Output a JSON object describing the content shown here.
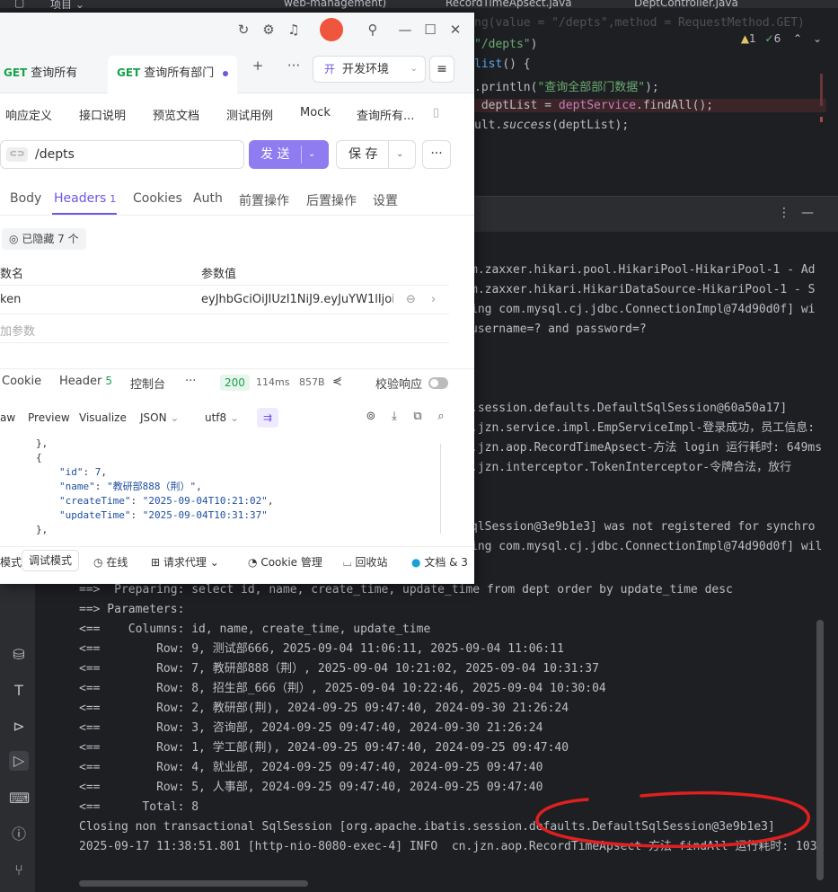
{
  "ide": {
    "titlebar": {
      "project_label": "项目",
      "project_chevron": "⌄",
      "module_tab": "web-management)",
      "tab_record": "RecordTimeApsect.java",
      "tab_dept": "DeptController.java"
    },
    "inspections": {
      "warnings": "1",
      "ok": "6"
    },
    "code_lines": [
      {
        "pre": "ng(value = \"/depts\",method = RequestMethod.GET)",
        "kind": "plain"
      },
      {
        "pre": "",
        "str": "\"/depts\"",
        "post": ")",
        "kind": "mapping"
      },
      {
        "pre": "",
        "fn": "list",
        "post": "() {",
        "kind": "method"
      },
      {
        "pre": ".println(",
        "str": "\"查询全部部门数据\"",
        "post": ");",
        "kind": "println"
      },
      {
        "pre": " deptList = ",
        "field": "deptService",
        "post2": ".findAll();",
        "kind": "assign"
      },
      {
        "pre": "ult.",
        "it": "success",
        "post": "(deptList);",
        "kind": "return"
      }
    ],
    "console_lines": [
      "m.zaxxer.hikari.pool.HikariPool-HikariPool-1 - Ad",
      "m.zaxxer.hikari.HikariDataSource-HikariPool-1 - S",
      "ing com.mysql.cj.jdbc.ConnectionImpl@74d90d0f] wi",
      "username=? and password=?",
      "",
      "",
      "",
      ".session.defaults.DefaultSqlSession@60a50a17]",
      ".jzn.service.impl.EmpServiceImpl-登录成功，员工信息:",
      ".jzn.aop.RecordTimeApsect-方法 login 运行耗时: 649ms",
      ".jzn.interceptor.TokenInterceptor-令牌合法，放行",
      "",
      "",
      "qlSession@3e9b1e3] was not registered for synchro",
      "ing com.mysql.cj.jdbc.ConnectionImpl@74d90d0f] wil"
    ],
    "sql_lines": [
      "==>  Preparing: select id, name, create_time, update_time from dept order by update_time desc",
      "==> Parameters: ",
      "<==    Columns: id, name, create_time, update_time",
      "<==        Row: 9, 测试部666, 2025-09-04 11:06:11, 2025-09-04 11:06:11",
      "<==        Row: 7, 教研部888（荆）, 2025-09-04 10:21:02, 2025-09-04 10:31:37",
      "<==        Row: 8, 招生部_666（荆）, 2025-09-04 10:22:46, 2025-09-04 10:30:04",
      "<==        Row: 2, 教研部(荆), 2024-09-25 09:47:40, 2024-09-30 21:26:24",
      "<==        Row: 3, 咨询部, 2024-09-25 09:47:40, 2024-09-30 21:26:24",
      "<==        Row: 1, 学工部(荆), 2024-09-25 09:47:40, 2024-09-25 09:47:40",
      "<==        Row: 4, 就业部, 2024-09-25 09:47:40, 2024-09-25 09:47:40",
      "<==        Row: 5, 人事部, 2024-09-25 09:47:40, 2024-09-25 09:47:40",
      "<==      Total: 8",
      "Closing non transactional SqlSession [org.apache.ibatis.session.defaults.DefaultSqlSession@3e9b1e3]",
      "2025-09-17 11:38:51.801 [http-nio-8080-exec-4] INFO  cn.jzn.aop.RecordTimeApsect-方法 findAll 运行耗时: 103"
    ],
    "colors": {
      "background": "#1e1f22",
      "annotation": "#e02020"
    }
  },
  "apifox": {
    "tabs": [
      {
        "method": "GET",
        "label": "查询所有"
      },
      {
        "method": "GET",
        "label": "查询所有部门"
      }
    ],
    "env": {
      "badge": "开",
      "label": "开发环境"
    },
    "doc_tabs": [
      "响应定义",
      "接口说明",
      "预览文档",
      "测试用例",
      "Mock",
      "查询所有..."
    ],
    "url": {
      "link_icon": "⊂⊃",
      "path": "/depts"
    },
    "send_label": "发 送",
    "save_label": "保 存",
    "param_tabs": [
      {
        "label": "Body"
      },
      {
        "label": "Headers",
        "count": "1"
      },
      {
        "label": "Cookies"
      },
      {
        "label": "Auth"
      },
      {
        "label": "前置操作"
      },
      {
        "label": "后置操作"
      },
      {
        "label": "设置"
      }
    ],
    "hidden_chip": "已隐藏 7 个",
    "headers_table": {
      "col_name": "数名",
      "col_value": "参数值",
      "rows": [
        {
          "name": "ken",
          "value": "eyJhbGciOiJIUzI1NiJ9.eyJuYW1lIjoi"
        }
      ],
      "add_placeholder": "加参数"
    },
    "response": {
      "tabs": [
        {
          "label": "Cookie"
        },
        {
          "label": "Header",
          "count": "5"
        },
        {
          "label": "控制台"
        }
      ],
      "more": "···",
      "status": "200",
      "time": "114ms",
      "size": "857B",
      "verify_label": "校验响应"
    },
    "view_opts": {
      "raw": "aw",
      "preview": "Preview",
      "visualize": "Visualize",
      "format": "JSON",
      "encoding": "utf8"
    },
    "json_lines": [
      {
        "indent": 8,
        "text": "},"
      },
      {
        "indent": 8,
        "text": "{"
      },
      {
        "indent": 16,
        "key": "\"id\"",
        "val": "7",
        "tail": ","
      },
      {
        "indent": 16,
        "key": "\"name\"",
        "val": "\"教研部888（荆）\"",
        "tail": ","
      },
      {
        "indent": 16,
        "key": "\"createTime\"",
        "val": "\"2025-09-04T10:21:02\"",
        "tail": ","
      },
      {
        "indent": 16,
        "key": "\"updateTime\"",
        "val": "\"2025-09-04T10:31:37\"",
        "tail": ""
      },
      {
        "indent": 8,
        "text": "},"
      }
    ],
    "status_bar": {
      "mode_partial": "模式",
      "debug_mode": "调试模式",
      "online": "在线",
      "proxy": "请求代理",
      "cookie_mgr": "Cookie 管理",
      "recycle": "回收站",
      "docs": "文档 & 3"
    },
    "colors": {
      "accent": "#6b57e6",
      "send": "#8f7cf0",
      "get": "#17a34a"
    }
  }
}
